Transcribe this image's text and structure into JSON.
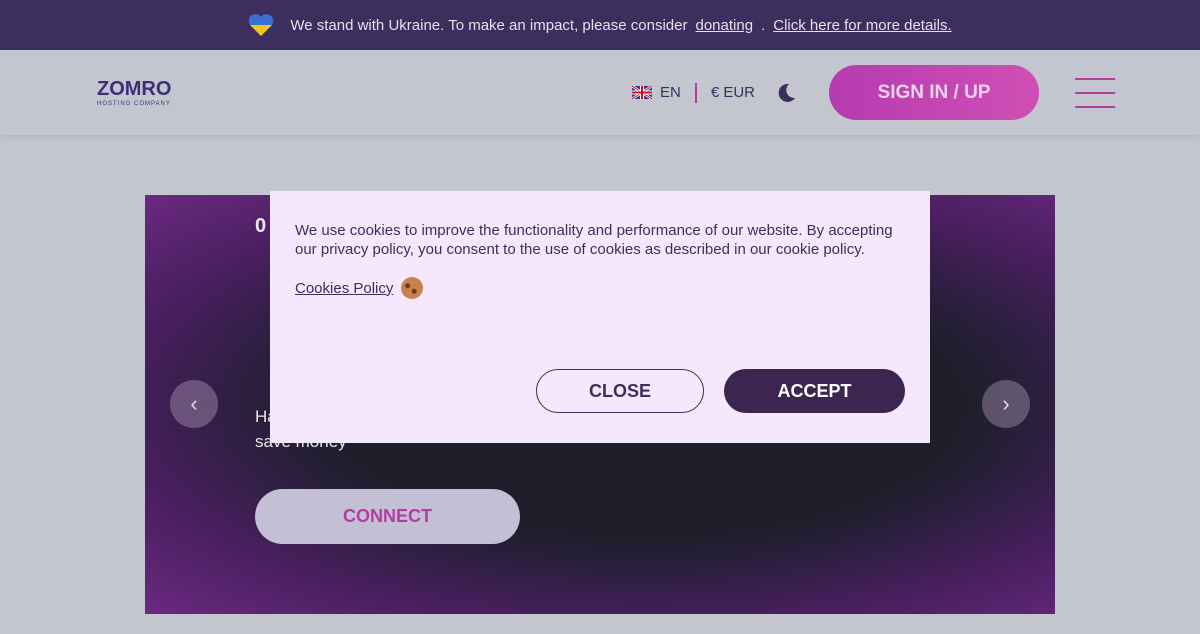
{
  "banner": {
    "text": "We stand with Ukraine. To make an impact, please consider",
    "donate_link": "donating",
    "dot": ".",
    "details_link": "Click here for more details."
  },
  "header": {
    "logo_name": "ZOMRO",
    "logo_sub": "HOSTING COMPANY",
    "language": "EN",
    "currency": "€ EUR",
    "signin_label": "SIGN IN / UP"
  },
  "hero": {
    "partial_top": "0",
    "partial_text": "Ha",
    "partial_text2": "save money",
    "connect_label": "CONNECT",
    "prev": "‹",
    "next": "›"
  },
  "cookie_modal": {
    "text": "We use cookies to improve the functionality and performance of our website. By accepting our privacy policy, you consent to the use of cookies as described in our cookie policy.",
    "policy_link": "Cookies Policy",
    "close_label": "CLOSE",
    "accept_label": "ACCEPT"
  },
  "colors": {
    "accent": "#b43d9f",
    "banner": "#3c2f5d",
    "modal_bg": "#f5e8fc"
  }
}
